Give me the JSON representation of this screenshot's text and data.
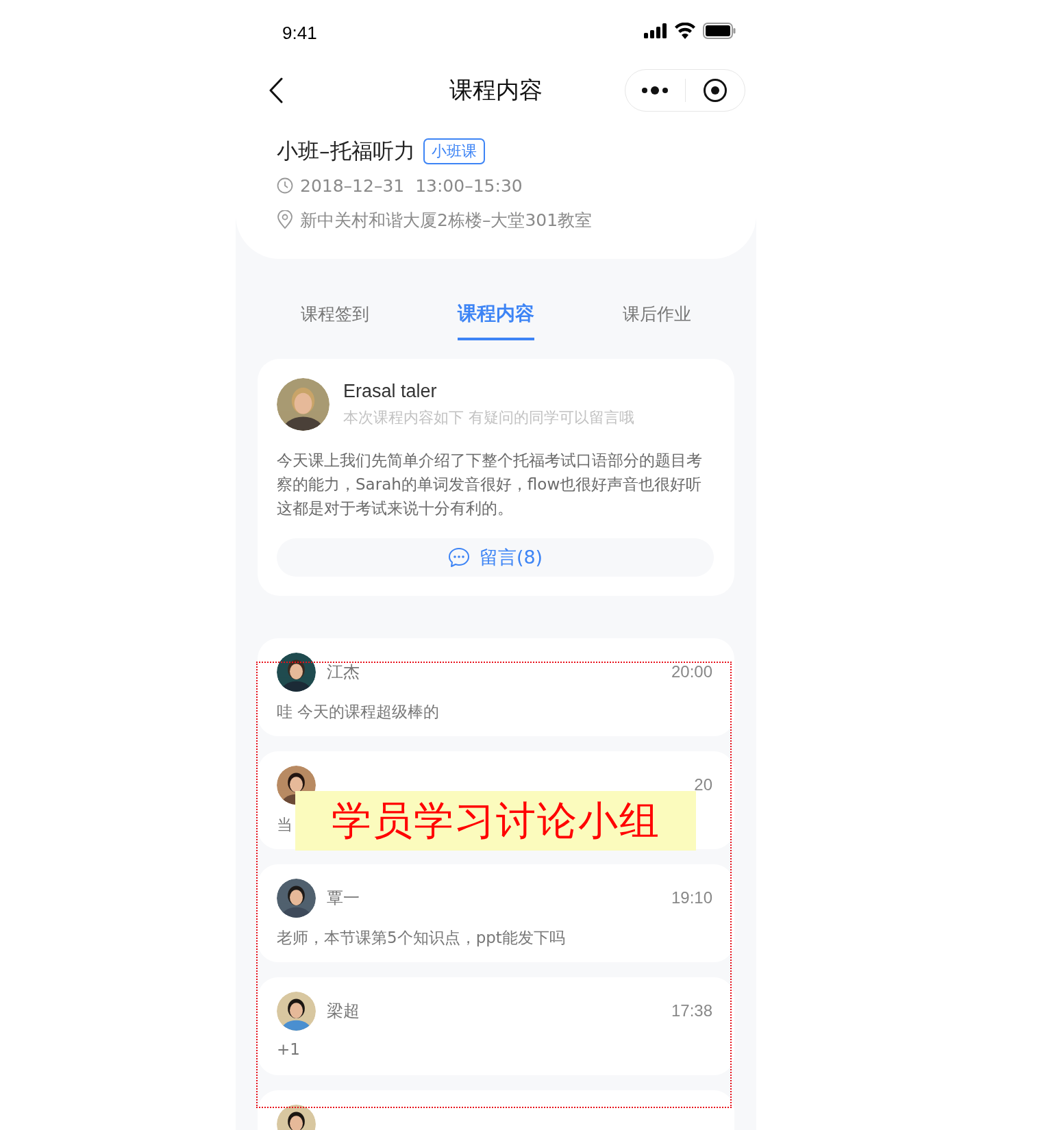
{
  "status_bar": {
    "time": "9:41"
  },
  "nav": {
    "title": "课程内容"
  },
  "course": {
    "title": "小班–托福听力",
    "tag": "小班课",
    "date": "2018–12–31  13:00–15:30",
    "location": "新中关村和谐大厦2栋楼–大堂301教室"
  },
  "tabs": [
    {
      "label": "课程签到",
      "selected": false
    },
    {
      "label": "课程内容",
      "selected": true
    },
    {
      "label": "课后作业",
      "selected": false
    }
  ],
  "post": {
    "author": "Erasal taler",
    "subtitle": "本次课程内容如下 有疑问的同学可以留言哦",
    "body": "今天课上我们先简单介绍了下整个托福考试口语部分的题目考察的能力，Sarah的单词发音很好，flow也很好声音也很好听这都是对于考试来说十分有利的。",
    "comment_button": "留言(8)"
  },
  "comments": [
    {
      "kind": "comment",
      "name": "江杰",
      "time": "20:00",
      "text": "哇 今天的课程超级棒的"
    },
    {
      "kind": "covered",
      "time": "20",
      "text": "当"
    },
    {
      "kind": "comment",
      "name": "覃一",
      "time": "19:10",
      "text": "老师，本节课第5个知识点，ppt能发下吗"
    },
    {
      "kind": "comment",
      "name": "梁超",
      "time": "17:38",
      "text": "+1"
    },
    {
      "kind": "clipped"
    }
  ],
  "annotation": {
    "label": "学员学习讨论小组"
  }
}
